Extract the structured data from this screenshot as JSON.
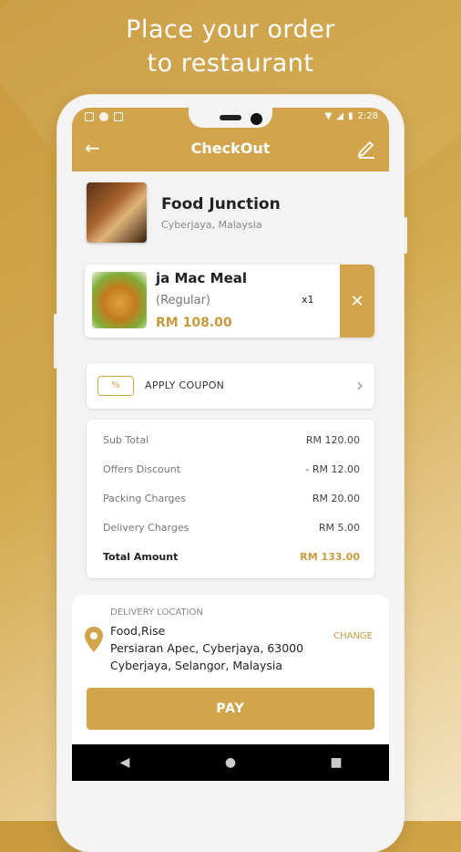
{
  "promo": {
    "line1": "Place your order",
    "line2": "to restaurant"
  },
  "status_bar": {
    "time": "2:28"
  },
  "app_bar": {
    "title": "CheckOut",
    "back_icon": "arrow-left-icon",
    "edit_icon": "pencil-icon"
  },
  "restaurant": {
    "name": "Food Junction",
    "location": "Cyberjaya, Malaysia"
  },
  "cart_item": {
    "name": "ja Mac Meal",
    "variant": "(Regular)",
    "quantity": "x1",
    "price": "RM 108.00",
    "remove_icon": "close-icon"
  },
  "coupon": {
    "label": "APPLY COUPON",
    "icon_text": "%"
  },
  "summary": {
    "rows": [
      {
        "label": "Sub Total",
        "value": "RM 120.00"
      },
      {
        "label": "Offers Discount",
        "value": "- RM 12.00"
      },
      {
        "label": "Packing Charges",
        "value": "RM 20.00"
      },
      {
        "label": "Delivery Charges",
        "value": "RM 5.00"
      }
    ],
    "total_label": "Total Amount",
    "total_value": "RM 133.00"
  },
  "delivery": {
    "label": "DELIVERY LOCATION",
    "address": "Food,Rise\n Persiaran Apec, Cyberjaya, 63000\nCyberjaya, Selangor, Malaysia",
    "change_label": "CHANGE"
  },
  "pay_label": "PAY",
  "nav": {
    "back": "◀",
    "home": "●",
    "recents": "■"
  },
  "colors": {
    "accent": "#d2a54d",
    "price": "#c69a3c"
  }
}
